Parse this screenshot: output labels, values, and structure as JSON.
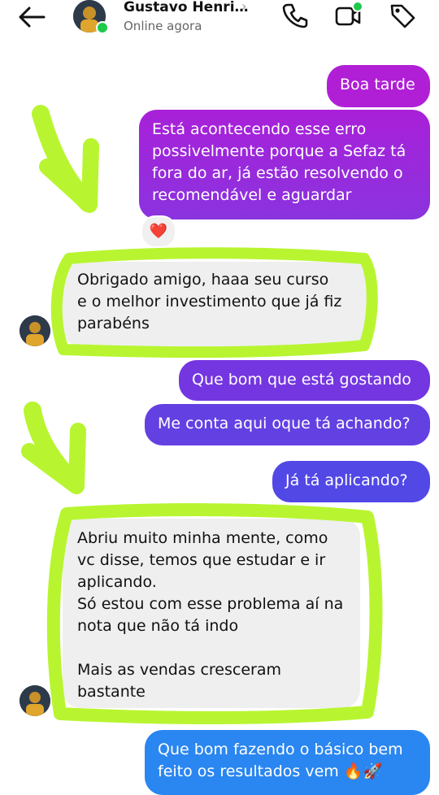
{
  "header": {
    "contact_name": "Gustavo Henri…",
    "name_chevron": "›",
    "status": "Online agora",
    "icons": [
      "back-arrow-icon",
      "phone-icon",
      "video-camera-icon",
      "tag-icon"
    ]
  },
  "messages": [
    {
      "direction": "outgoing",
      "text": "Boa tarde"
    },
    {
      "direction": "outgoing",
      "text": "Está acontecendo esse erro\npossivelmente porque a Sefaz tá\nfora do ar, já estão resolvendo o\nrecomendável e aguardar",
      "reaction": "❤️"
    },
    {
      "direction": "incoming",
      "text": "Obrigado amigo, haaa seu curso\ne o melhor investimento que já fiz\nparabéns"
    },
    {
      "direction": "outgoing",
      "text": "Que bom que está gostando"
    },
    {
      "direction": "outgoing",
      "text": "Me conta aqui oque tá achando?"
    },
    {
      "direction": "outgoing",
      "text": "Já tá aplicando?"
    },
    {
      "direction": "incoming",
      "text": "Abriu muito minha mente, como\nvc disse, temos que estudar e ir\naplicando.\nSó estou com esse problema aí na\nnota que não tá indo\n\nMais as vendas cresceram\nbastante"
    },
    {
      "direction": "outgoing",
      "text": "Que bom fazendo o básico bem\nfeito os resultados vem 🔥🚀"
    }
  ],
  "colors": {
    "gradient_top": "#b01fd6",
    "gradient_mid": "#6a3be0",
    "gradient_bottom": "#2a86f0",
    "incoming_bubble": "#efefef",
    "highlight": "#b8f530",
    "online": "#1ec94b"
  }
}
